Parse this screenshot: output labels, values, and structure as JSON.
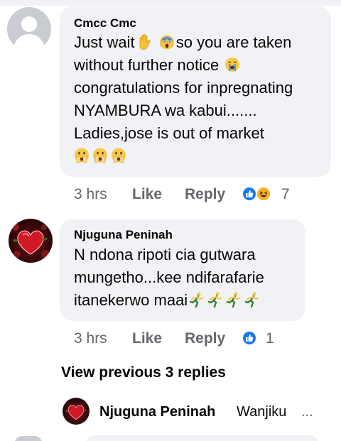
{
  "colors": {
    "bubble_bg": "#f0f2f5",
    "meta_gray": "#65676b",
    "like_blue": "#1877f2",
    "haha_yellow": "#f7b125"
  },
  "comment1": {
    "author": "Cmcc Cmc",
    "line1a": "Just wait",
    "line1b": "so you are taken",
    "line2": "without further notice",
    "line3": "congratulations for inpregnating",
    "line4": "NYAMBURA wa kabui.......",
    "line5": "Ladies,jose is out of market",
    "emojis": [
      "raised-hand-icon",
      "screaming-face-icon",
      "crying-face-icon",
      "hand-over-mouth-icon"
    ],
    "time": "3 hrs",
    "like_label": "Like",
    "reply_label": "Reply",
    "reaction_icons": [
      "like-reaction-icon",
      "haha-reaction-icon"
    ],
    "reaction_count": "7"
  },
  "comment2": {
    "author": "Njuguna Peninah",
    "line1": "N ndona ripoti cia gutwara",
    "line2": "mungetho...kee ndifarafarie",
    "line3": "itanekerwo maai",
    "emojis": [
      "running-person-icon"
    ],
    "time": "3 hrs",
    "like_label": "Like",
    "reply_label": "Reply",
    "reaction_icons": [
      "like-reaction-icon"
    ],
    "reaction_count": "1"
  },
  "view_previous": "View previous 3 replies",
  "reply_preview": {
    "author": "Njuguna Peninah",
    "text": "Wanjiku",
    "ellipsis": "..."
  }
}
